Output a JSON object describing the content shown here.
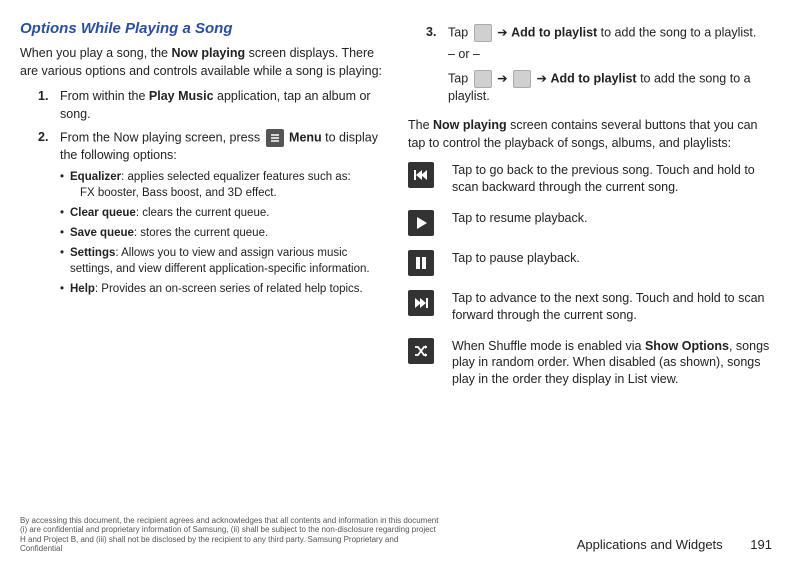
{
  "title": "Options While Playing a Song",
  "intro": "When you play a song, the ",
  "intro_bold": "Now playing",
  "intro2": " screen displays. There are various options and controls available while a song is playing:",
  "steps_left": {
    "s1": {
      "num": "1.",
      "pre": "From within the ",
      "bold": "Play Music",
      "post": " application, tap an album or song."
    },
    "s2": {
      "num": "2.",
      "pre": "From the Now playing screen, press ",
      "bold": "Menu",
      "post": " to display the following options:"
    }
  },
  "bullets": {
    "b1": {
      "bold": "Equalizer",
      "rest": ": applies selected equalizer features such as:",
      "line2": "FX booster, Bass boost, and 3D effect."
    },
    "b2": {
      "bold": "Clear queue",
      "rest": ": clears the current queue."
    },
    "b3": {
      "bold": "Save queue",
      "rest": ": stores the current queue."
    },
    "b4": {
      "bold": "Settings",
      "rest": ": Allows you to view and assign various music settings, and view different application-specific information."
    },
    "b5": {
      "bold": "Help",
      "rest": ": Provides an on-screen series of related help topics."
    }
  },
  "steps_right": {
    "s3a": {
      "num": "3.",
      "pre": "Tap ",
      "arrow": " ➔ ",
      "bold": "Add to playlist",
      "post": " to add the song to a playlist."
    },
    "or": "– or –",
    "s3b": {
      "pre": "Tap ",
      "arrow": " ➔ ",
      "arrow2": " ➔ ",
      "bold": "Add to playlist",
      "post": " to add the song to a playlist."
    }
  },
  "after": {
    "pre": "The ",
    "bold": "Now playing",
    "post": " screen contains several buttons that you can tap to control the playback of songs, albums, and playlists:"
  },
  "controls": {
    "c1": "Tap to go back to the previous song. Touch and hold to scan backward through the current song.",
    "c2": "Tap to resume playback.",
    "c3": "Tap to pause playback.",
    "c4": "Tap to advance to the next song. Touch and hold to scan forward through the current song.",
    "c5_pre": "When Shuffle mode is enabled via ",
    "c5_bold": "Show Options",
    "c5_post": ", songs play in random order. When disabled (as shown), songs play in the order they display in List view."
  },
  "footer": {
    "legal": "By accessing this document, the recipient agrees and acknowledges that all contents and information in this document (i) are confidential and proprietary information of Samsung, (ii) shall be subject to the non-disclosure regarding project H and Project B, and (iii) shall not be disclosed by the recipient to any third party. Samsung Proprietary and Confidential",
    "section": "Applications and Widgets",
    "page": "191"
  }
}
